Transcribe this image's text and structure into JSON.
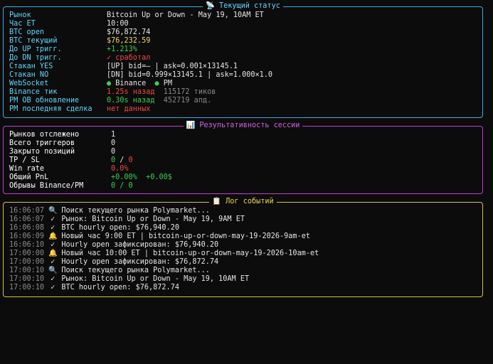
{
  "status": {
    "title": "📡 Текущий статус",
    "rows": {
      "market": {
        "label": "Рынок",
        "value": "Bitcoin Up or Down - May 19, 10AM ET"
      },
      "hour": {
        "label": "Час ET",
        "value": "10:00"
      },
      "btc_open": {
        "label": "BTC open",
        "value": "$76,872.74"
      },
      "btc_current": {
        "label": "BTC текущий",
        "value": "$76,232.59"
      },
      "up_trigger": {
        "label": "До UP тригг.",
        "value": "+1.213%"
      },
      "dn_trigger": {
        "label": "До DN тригг.",
        "value": "✓ сработал"
      },
      "book_yes": {
        "label": "Стакан YES",
        "value": "[UP] bid=– | ask=0.001×13145.1"
      },
      "book_no": {
        "label": "Стакан NO",
        "value": "[DN] bid=0.999×13145.1 | ask=1.000×1.0"
      },
      "websocket": {
        "label": "WebSocket",
        "binance": "Binance",
        "pm": "PM"
      },
      "binance_tick": {
        "label": "Binance тик",
        "value": "1.25s назад",
        "extra": "115172 тиков"
      },
      "pm_ob": {
        "label": "PM OB обновление",
        "value": "0.30s назад",
        "extra": "452719 апд."
      },
      "pm_last": {
        "label": "PM последняя сделка",
        "value": "нет данных"
      }
    }
  },
  "session": {
    "title": "📊 Результативность сессии",
    "rows": {
      "markets": {
        "label": "Рынков отслежено",
        "value": "1"
      },
      "triggers": {
        "label": "Всего триггеров",
        "value": "0"
      },
      "closed": {
        "label": "Закрыто позиций",
        "value": "0"
      },
      "tpsl": {
        "label": "TP / SL",
        "tp": "0",
        "sep": " / ",
        "sl": "0"
      },
      "winrate": {
        "label": "Win rate",
        "value": "0.0%"
      },
      "pnl": {
        "label": "Общий PnL",
        "pct": "+0.00%",
        "usd": "+0.00$"
      },
      "breaks": {
        "label": "Обрывы Binance/PM",
        "binance": "0",
        "sep": " / ",
        "pm": "0"
      }
    }
  },
  "log": {
    "title": "📋 Лог событий",
    "entries": [
      {
        "time": "16:06:07",
        "icon": "search-icon",
        "glyph": "🔍",
        "text": "Поиск текущего рынка Polymarket..."
      },
      {
        "time": "16:06:07",
        "icon": "check-icon",
        "glyph": "✓",
        "text": "Рынок: Bitcoin Up or Down - May 19, 9AM ET"
      },
      {
        "time": "16:06:08",
        "icon": "check-icon",
        "glyph": "✓",
        "text": "BTC hourly open: $76,940.20"
      },
      {
        "time": "16:06:09",
        "icon": "bell-icon",
        "glyph": "🔔",
        "text": "Новый час 9:00 ET | bitcoin-up-or-down-may-19-2026-9am-et"
      },
      {
        "time": "16:06:10",
        "icon": "check-icon",
        "glyph": "✓",
        "text": "Hourly open зафиксирован: $76,940.20"
      },
      {
        "time": "17:00:00",
        "icon": "bell-icon",
        "glyph": "🔔",
        "text": "Новый час 10:00 ET | bitcoin-up-or-down-may-19-2026-10am-et"
      },
      {
        "time": "17:00:00",
        "icon": "check-icon",
        "glyph": "✓",
        "text": "Hourly open зафиксирован: $76,872.74"
      },
      {
        "time": "17:00:10",
        "icon": "search-icon",
        "glyph": "🔍",
        "text": "Поиск текущего рынка Polymarket..."
      },
      {
        "time": "17:00:10",
        "icon": "check-icon",
        "glyph": "✓",
        "text": "Рынок: Bitcoin Up or Down - May 19, 10AM ET"
      },
      {
        "time": "17:00:10",
        "icon": "check-icon",
        "glyph": "✓",
        "text": "BTC hourly open: $76,872.74"
      }
    ]
  },
  "colors": {
    "status_border": "#3fa9e6",
    "session_border": "#c43cd6",
    "log_border": "#d7c431",
    "positive": "#3ccf4e",
    "negative": "#f24848"
  }
}
